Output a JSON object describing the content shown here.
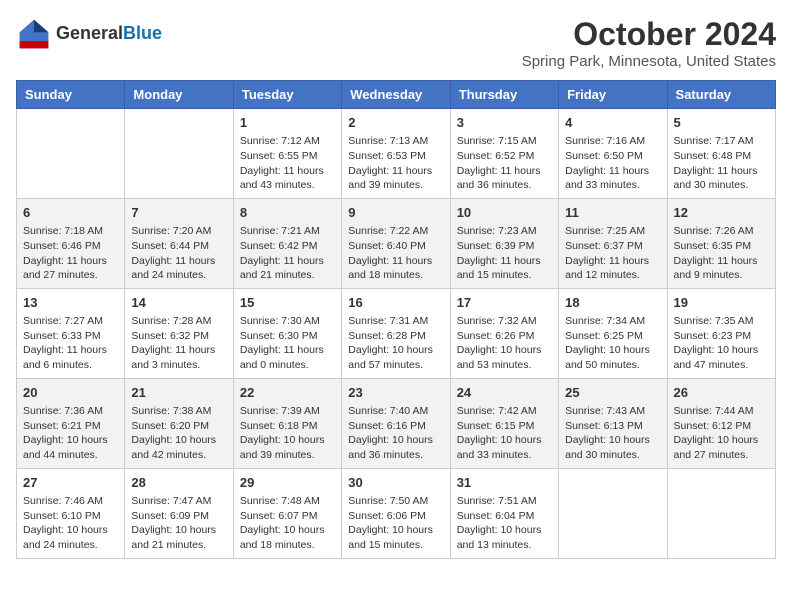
{
  "header": {
    "logo_line1": "General",
    "logo_line2": "Blue",
    "month_title": "October 2024",
    "location": "Spring Park, Minnesota, United States"
  },
  "days_of_week": [
    "Sunday",
    "Monday",
    "Tuesday",
    "Wednesday",
    "Thursday",
    "Friday",
    "Saturday"
  ],
  "weeks": [
    [
      {
        "day": "",
        "content": ""
      },
      {
        "day": "",
        "content": ""
      },
      {
        "day": "1",
        "content": "Sunrise: 7:12 AM\nSunset: 6:55 PM\nDaylight: 11 hours and 43 minutes."
      },
      {
        "day": "2",
        "content": "Sunrise: 7:13 AM\nSunset: 6:53 PM\nDaylight: 11 hours and 39 minutes."
      },
      {
        "day": "3",
        "content": "Sunrise: 7:15 AM\nSunset: 6:52 PM\nDaylight: 11 hours and 36 minutes."
      },
      {
        "day": "4",
        "content": "Sunrise: 7:16 AM\nSunset: 6:50 PM\nDaylight: 11 hours and 33 minutes."
      },
      {
        "day": "5",
        "content": "Sunrise: 7:17 AM\nSunset: 6:48 PM\nDaylight: 11 hours and 30 minutes."
      }
    ],
    [
      {
        "day": "6",
        "content": "Sunrise: 7:18 AM\nSunset: 6:46 PM\nDaylight: 11 hours and 27 minutes."
      },
      {
        "day": "7",
        "content": "Sunrise: 7:20 AM\nSunset: 6:44 PM\nDaylight: 11 hours and 24 minutes."
      },
      {
        "day": "8",
        "content": "Sunrise: 7:21 AM\nSunset: 6:42 PM\nDaylight: 11 hours and 21 minutes."
      },
      {
        "day": "9",
        "content": "Sunrise: 7:22 AM\nSunset: 6:40 PM\nDaylight: 11 hours and 18 minutes."
      },
      {
        "day": "10",
        "content": "Sunrise: 7:23 AM\nSunset: 6:39 PM\nDaylight: 11 hours and 15 minutes."
      },
      {
        "day": "11",
        "content": "Sunrise: 7:25 AM\nSunset: 6:37 PM\nDaylight: 11 hours and 12 minutes."
      },
      {
        "day": "12",
        "content": "Sunrise: 7:26 AM\nSunset: 6:35 PM\nDaylight: 11 hours and 9 minutes."
      }
    ],
    [
      {
        "day": "13",
        "content": "Sunrise: 7:27 AM\nSunset: 6:33 PM\nDaylight: 11 hours and 6 minutes."
      },
      {
        "day": "14",
        "content": "Sunrise: 7:28 AM\nSunset: 6:32 PM\nDaylight: 11 hours and 3 minutes."
      },
      {
        "day": "15",
        "content": "Sunrise: 7:30 AM\nSunset: 6:30 PM\nDaylight: 11 hours and 0 minutes."
      },
      {
        "day": "16",
        "content": "Sunrise: 7:31 AM\nSunset: 6:28 PM\nDaylight: 10 hours and 57 minutes."
      },
      {
        "day": "17",
        "content": "Sunrise: 7:32 AM\nSunset: 6:26 PM\nDaylight: 10 hours and 53 minutes."
      },
      {
        "day": "18",
        "content": "Sunrise: 7:34 AM\nSunset: 6:25 PM\nDaylight: 10 hours and 50 minutes."
      },
      {
        "day": "19",
        "content": "Sunrise: 7:35 AM\nSunset: 6:23 PM\nDaylight: 10 hours and 47 minutes."
      }
    ],
    [
      {
        "day": "20",
        "content": "Sunrise: 7:36 AM\nSunset: 6:21 PM\nDaylight: 10 hours and 44 minutes."
      },
      {
        "day": "21",
        "content": "Sunrise: 7:38 AM\nSunset: 6:20 PM\nDaylight: 10 hours and 42 minutes."
      },
      {
        "day": "22",
        "content": "Sunrise: 7:39 AM\nSunset: 6:18 PM\nDaylight: 10 hours and 39 minutes."
      },
      {
        "day": "23",
        "content": "Sunrise: 7:40 AM\nSunset: 6:16 PM\nDaylight: 10 hours and 36 minutes."
      },
      {
        "day": "24",
        "content": "Sunrise: 7:42 AM\nSunset: 6:15 PM\nDaylight: 10 hours and 33 minutes."
      },
      {
        "day": "25",
        "content": "Sunrise: 7:43 AM\nSunset: 6:13 PM\nDaylight: 10 hours and 30 minutes."
      },
      {
        "day": "26",
        "content": "Sunrise: 7:44 AM\nSunset: 6:12 PM\nDaylight: 10 hours and 27 minutes."
      }
    ],
    [
      {
        "day": "27",
        "content": "Sunrise: 7:46 AM\nSunset: 6:10 PM\nDaylight: 10 hours and 24 minutes."
      },
      {
        "day": "28",
        "content": "Sunrise: 7:47 AM\nSunset: 6:09 PM\nDaylight: 10 hours and 21 minutes."
      },
      {
        "day": "29",
        "content": "Sunrise: 7:48 AM\nSunset: 6:07 PM\nDaylight: 10 hours and 18 minutes."
      },
      {
        "day": "30",
        "content": "Sunrise: 7:50 AM\nSunset: 6:06 PM\nDaylight: 10 hours and 15 minutes."
      },
      {
        "day": "31",
        "content": "Sunrise: 7:51 AM\nSunset: 6:04 PM\nDaylight: 10 hours and 13 minutes."
      },
      {
        "day": "",
        "content": ""
      },
      {
        "day": "",
        "content": ""
      }
    ]
  ]
}
